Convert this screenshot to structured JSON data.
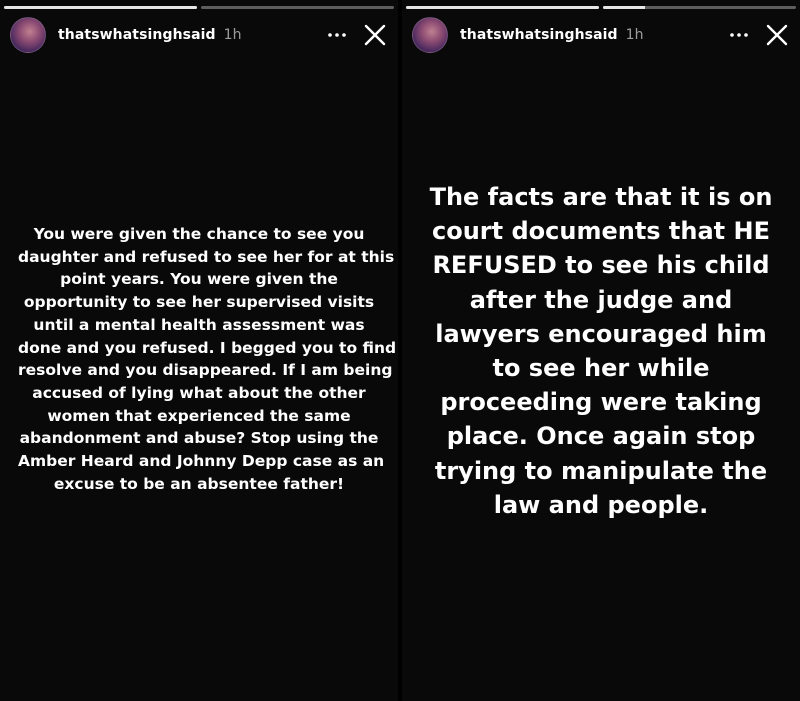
{
  "stories": [
    {
      "username": "thatswhatsinghsaid",
      "time": "1h",
      "progress": [
        1,
        0
      ],
      "text_lines": [
        "You were given the chance to see you",
        "daughter and refused to see her for at this",
        "point years. You were given the",
        "opportunity to see her supervised visits",
        "until a mental health assessment was",
        "done and you refused. I begged you to find",
        "resolve and you disappeared. If I am being",
        "accused of lying what about the other",
        "women that experienced the same",
        "abandonment and abuse? Stop using the",
        "Amber Heard and Johnny Depp case as an",
        "excuse to be an absentee father!"
      ]
    },
    {
      "username": "thatswhatsinghsaid",
      "time": "1h",
      "progress": [
        1,
        0.22
      ],
      "text_lines": [
        "The facts are that it is on",
        "court documents that HE",
        "REFUSED to see his child",
        "after the judge and",
        "lawyers encouraged him",
        "to see her while",
        "proceeding were taking",
        "place.  Once again stop",
        "trying to manipulate the",
        "law and people."
      ]
    }
  ],
  "icons": {
    "more": "more-options-icon",
    "close": "close-icon"
  }
}
